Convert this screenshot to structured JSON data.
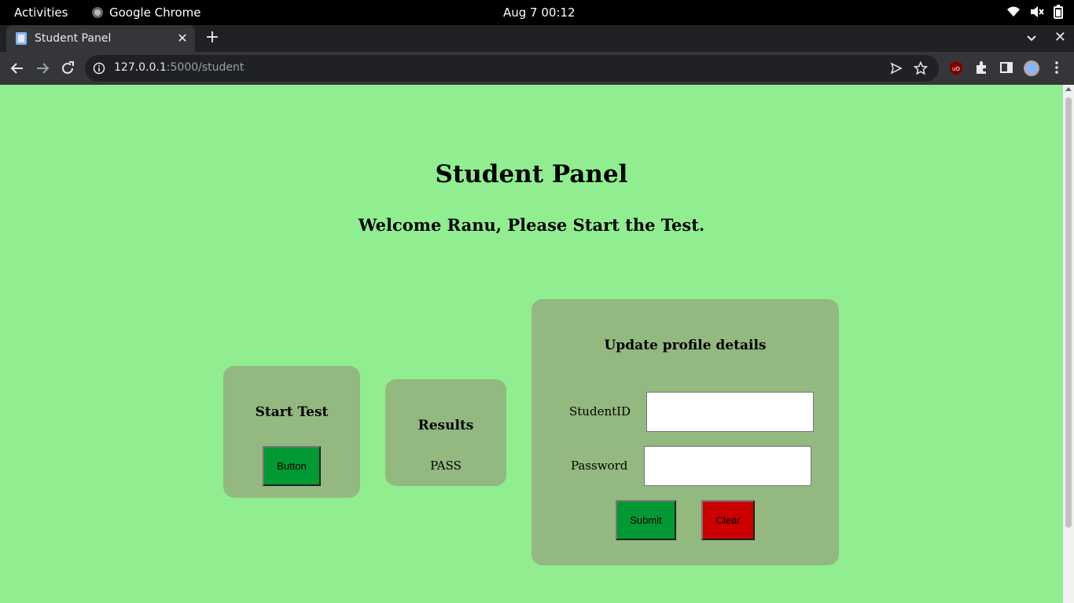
{
  "system": {
    "activities": "Activities",
    "app_name": "Google Chrome",
    "clock": "Aug 7  00:12"
  },
  "browser": {
    "tab_title": "Student Panel",
    "url_host": "127.0.0.1",
    "url_path": ":5000/student"
  },
  "page": {
    "title": "Student Panel",
    "welcome": "Welcome Ranu, Please Start the Test.",
    "start_card": {
      "heading": "Start Test",
      "button_label": "Button"
    },
    "results_card": {
      "heading": "Results",
      "value": "PASS"
    },
    "profile_card": {
      "heading": "Update profile details",
      "student_id_label": "StudentID",
      "student_id_value": "",
      "password_label": "Password",
      "password_value": "",
      "submit_label": "Submit",
      "clear_label": "Clear"
    }
  },
  "colors": {
    "page_background": "#90ee90",
    "card_background": "#93b880",
    "green_button": "#009933",
    "red_button": "#cc0000"
  },
  "icons": [
    "wifi-icon",
    "volume-muted-icon",
    "battery-icon",
    "back-icon",
    "forward-icon",
    "reload-icon",
    "site-info-icon",
    "send-icon",
    "bookmark-star-icon",
    "ublock-icon",
    "extensions-icon",
    "side-panel-icon",
    "chrome-menu-icon"
  ]
}
